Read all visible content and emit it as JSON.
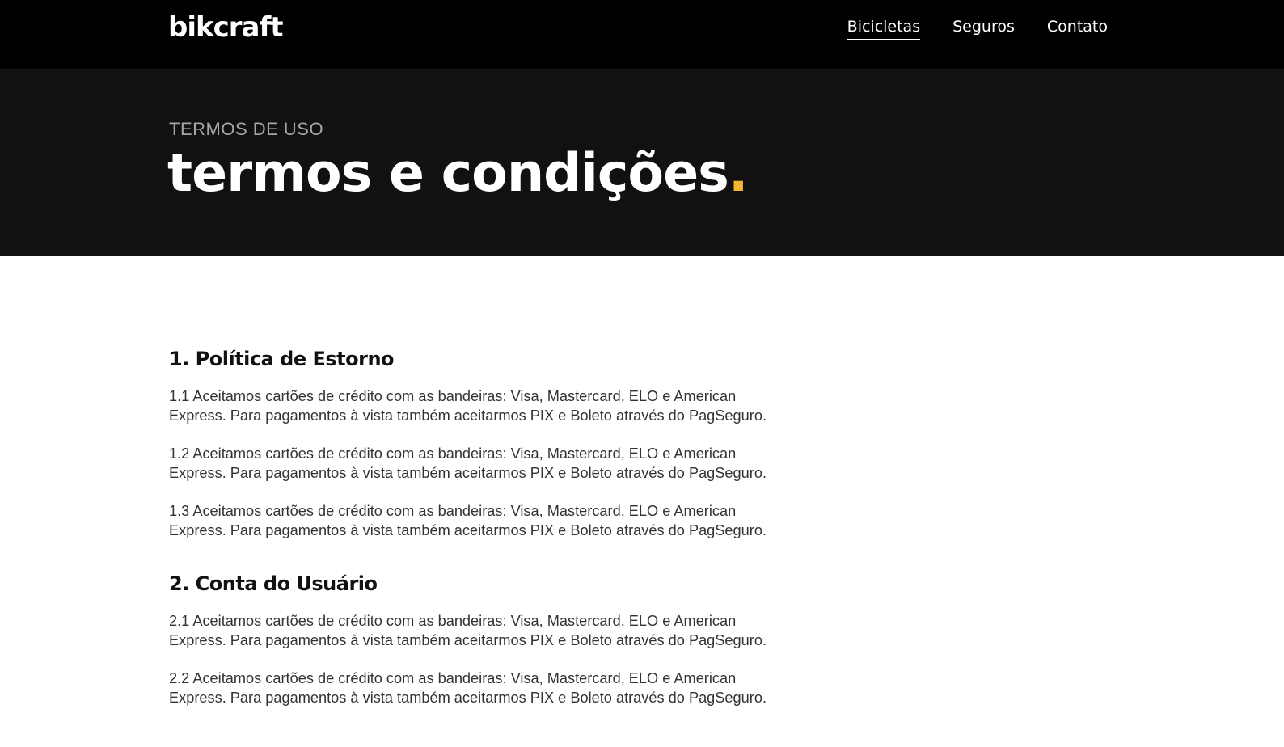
{
  "header": {
    "logo": "bikcraft",
    "nav": [
      {
        "label": "Bicicletas",
        "active": true
      },
      {
        "label": "Seguros",
        "active": false
      },
      {
        "label": "Contato",
        "active": false
      }
    ]
  },
  "hero": {
    "eyebrow": "TERMOS DE USO",
    "title": "termos e condições",
    "title_dot": ".",
    "accent_color": "#f6b430"
  },
  "sections": [
    {
      "heading": "1. Política de Estorno",
      "paragraphs": [
        "1.1 Aceitamos cartões de crédito com as bandeiras: Visa, Mastercard, ELO e American Express. Para pagamentos à vista também aceitarmos PIX e Boleto através do PagSeguro.",
        "1.2 Aceitamos cartões de crédito com as bandeiras: Visa, Mastercard, ELO e American Express. Para pagamentos à vista também aceitarmos PIX e Boleto através do PagSeguro.",
        "1.3 Aceitamos cartões de crédito com as bandeiras: Visa, Mastercard, ELO e American Express. Para pagamentos à vista também aceitarmos PIX e Boleto através do PagSeguro."
      ]
    },
    {
      "heading": "2. Conta do Usuário",
      "paragraphs": [
        "2.1 Aceitamos cartões de crédito com as bandeiras: Visa, Mastercard, ELO e American Express. Para pagamentos à vista também aceitarmos PIX e Boleto através do PagSeguro.",
        "2.2 Aceitamos cartões de crédito com as bandeiras: Visa, Mastercard, ELO e American Express. Para pagamentos à vista também aceitarmos PIX e Boleto através do PagSeguro."
      ]
    }
  ]
}
